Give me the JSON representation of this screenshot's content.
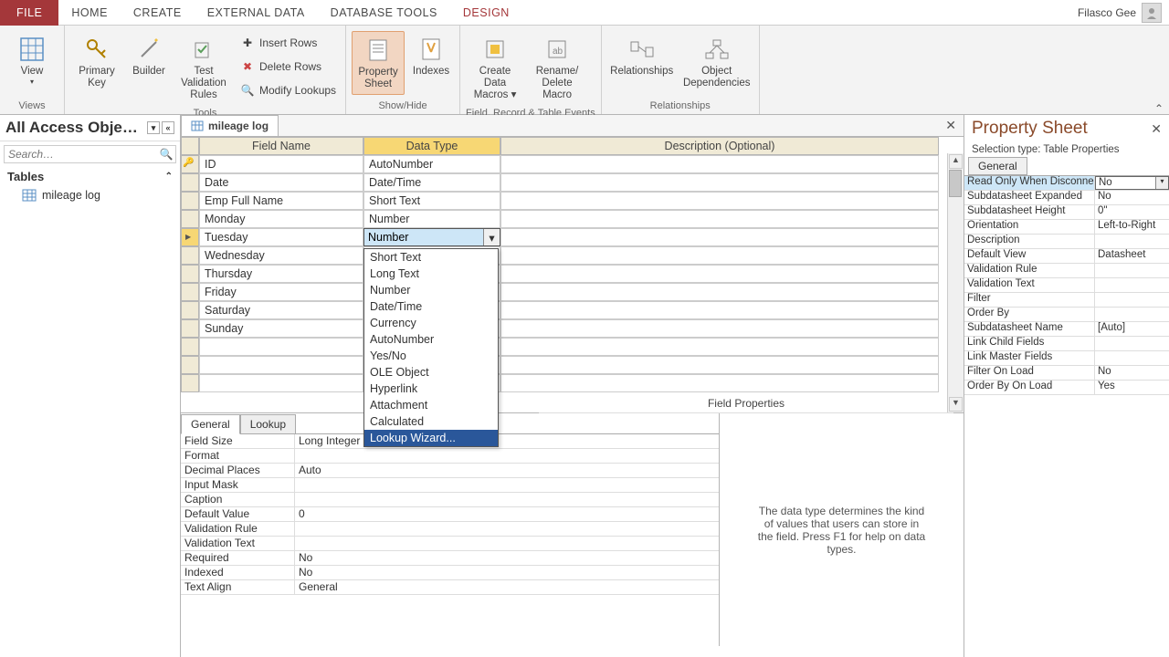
{
  "ribbon_tabs": {
    "file": "FILE",
    "home": "HOME",
    "create": "CREATE",
    "external": "EXTERNAL DATA",
    "dbtools": "DATABASE TOOLS",
    "design": "DESIGN"
  },
  "user": "Filasco Gee",
  "ribbon": {
    "views": {
      "view": "View",
      "label": "Views"
    },
    "tools": {
      "primary_key": "Primary Key",
      "builder": "Builder",
      "test_rules": "Test Validation Rules",
      "insert_rows": "Insert Rows",
      "delete_rows": "Delete Rows",
      "modify_lookups": "Modify Lookups",
      "label": "Tools"
    },
    "showhide": {
      "property_sheet": "Property Sheet",
      "indexes": "Indexes",
      "label": "Show/Hide"
    },
    "events": {
      "create_macros": "Create Data Macros ▾",
      "rename_delete": "Rename/ Delete Macro",
      "label": "Field, Record & Table Events"
    },
    "relationships": {
      "relationships": "Relationships",
      "obj_deps": "Object Dependencies",
      "label": "Relationships"
    }
  },
  "nav": {
    "title": "All Access Obje…",
    "search_placeholder": "Search…",
    "tables": "Tables",
    "item_mileage": "mileage log"
  },
  "doc_tab": "mileage log",
  "grid_headers": {
    "field_name": "Field Name",
    "data_type": "Data Type",
    "description": "Description (Optional)"
  },
  "fields": [
    {
      "name": "ID",
      "type": "AutoNumber"
    },
    {
      "name": "Date",
      "type": "Date/Time"
    },
    {
      "name": "Emp Full Name",
      "type": "Short Text"
    },
    {
      "name": "Monday",
      "type": "Number"
    },
    {
      "name": "Tuesday",
      "type": "Number"
    },
    {
      "name": "Wednesday",
      "type": ""
    },
    {
      "name": "Thursday",
      "type": ""
    },
    {
      "name": "Friday",
      "type": ""
    },
    {
      "name": "Saturday",
      "type": ""
    },
    {
      "name": "Sunday",
      "type": ""
    }
  ],
  "datatype_options": [
    "Short Text",
    "Long Text",
    "Number",
    "Date/Time",
    "Currency",
    "AutoNumber",
    "Yes/No",
    "OLE Object",
    "Hyperlink",
    "Attachment",
    "Calculated",
    "Lookup Wizard..."
  ],
  "field_props_title": "Field Properties",
  "fp_tabs": {
    "general": "General",
    "lookup": "Lookup"
  },
  "fp_rows": [
    {
      "lbl": "Field Size",
      "val": "Long Integer"
    },
    {
      "lbl": "Format",
      "val": ""
    },
    {
      "lbl": "Decimal Places",
      "val": "Auto"
    },
    {
      "lbl": "Input Mask",
      "val": ""
    },
    {
      "lbl": "Caption",
      "val": ""
    },
    {
      "lbl": "Default Value",
      "val": "0"
    },
    {
      "lbl": "Validation Rule",
      "val": ""
    },
    {
      "lbl": "Validation Text",
      "val": ""
    },
    {
      "lbl": "Required",
      "val": "No"
    },
    {
      "lbl": "Indexed",
      "val": "No"
    },
    {
      "lbl": "Text Align",
      "val": "General"
    }
  ],
  "fp_help": "The data type determines the kind of values that users can store in the field. Press F1 for help on data types.",
  "ps": {
    "title": "Property Sheet",
    "sel_type": "Selection type:  Table Properties",
    "tab": "General",
    "rows": [
      {
        "lbl": "Read Only When Disconnect",
        "val": "No",
        "sel": true
      },
      {
        "lbl": "Subdatasheet Expanded",
        "val": "No"
      },
      {
        "lbl": "Subdatasheet Height",
        "val": "0\""
      },
      {
        "lbl": "Orientation",
        "val": "Left-to-Right"
      },
      {
        "lbl": "Description",
        "val": ""
      },
      {
        "lbl": "Default View",
        "val": "Datasheet"
      },
      {
        "lbl": "Validation Rule",
        "val": ""
      },
      {
        "lbl": "Validation Text",
        "val": ""
      },
      {
        "lbl": "Filter",
        "val": ""
      },
      {
        "lbl": "Order By",
        "val": ""
      },
      {
        "lbl": "Subdatasheet Name",
        "val": "[Auto]"
      },
      {
        "lbl": "Link Child Fields",
        "val": ""
      },
      {
        "lbl": "Link Master Fields",
        "val": ""
      },
      {
        "lbl": "Filter On Load",
        "val": "No"
      },
      {
        "lbl": "Order By On Load",
        "val": "Yes"
      }
    ]
  }
}
